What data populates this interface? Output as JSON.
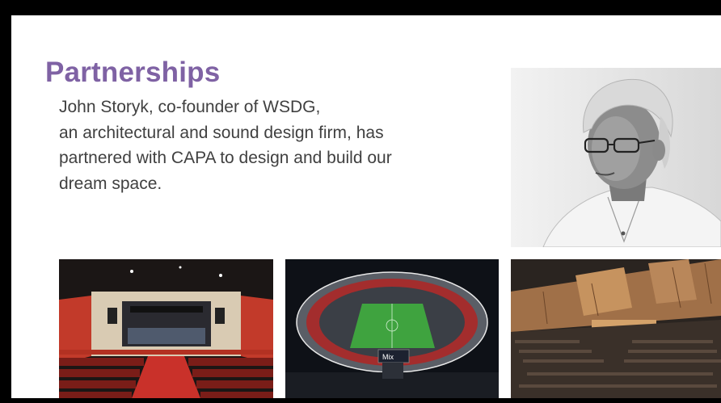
{
  "slide": {
    "title": "Partnerships",
    "body_lines": [
      "John Storyk, co-founder of WSDG,",
      "an architectural and sound design firm, has",
      "partnered with CAPA to design and build our",
      "dream space."
    ],
    "accent_color": "#7f62a4",
    "text_color": "#404040"
  },
  "images": {
    "portrait": {
      "label": "John Storyk portrait",
      "style": "grayscale"
    },
    "theater": {
      "label": "theater auditorium interior",
      "seat_color": "#c0302a"
    },
    "stadium": {
      "label": "football stadium at night",
      "pitch_color": "#3fa33f",
      "scoreboard_text": "Mix"
    },
    "hall": {
      "label": "concert hall interior"
    }
  }
}
